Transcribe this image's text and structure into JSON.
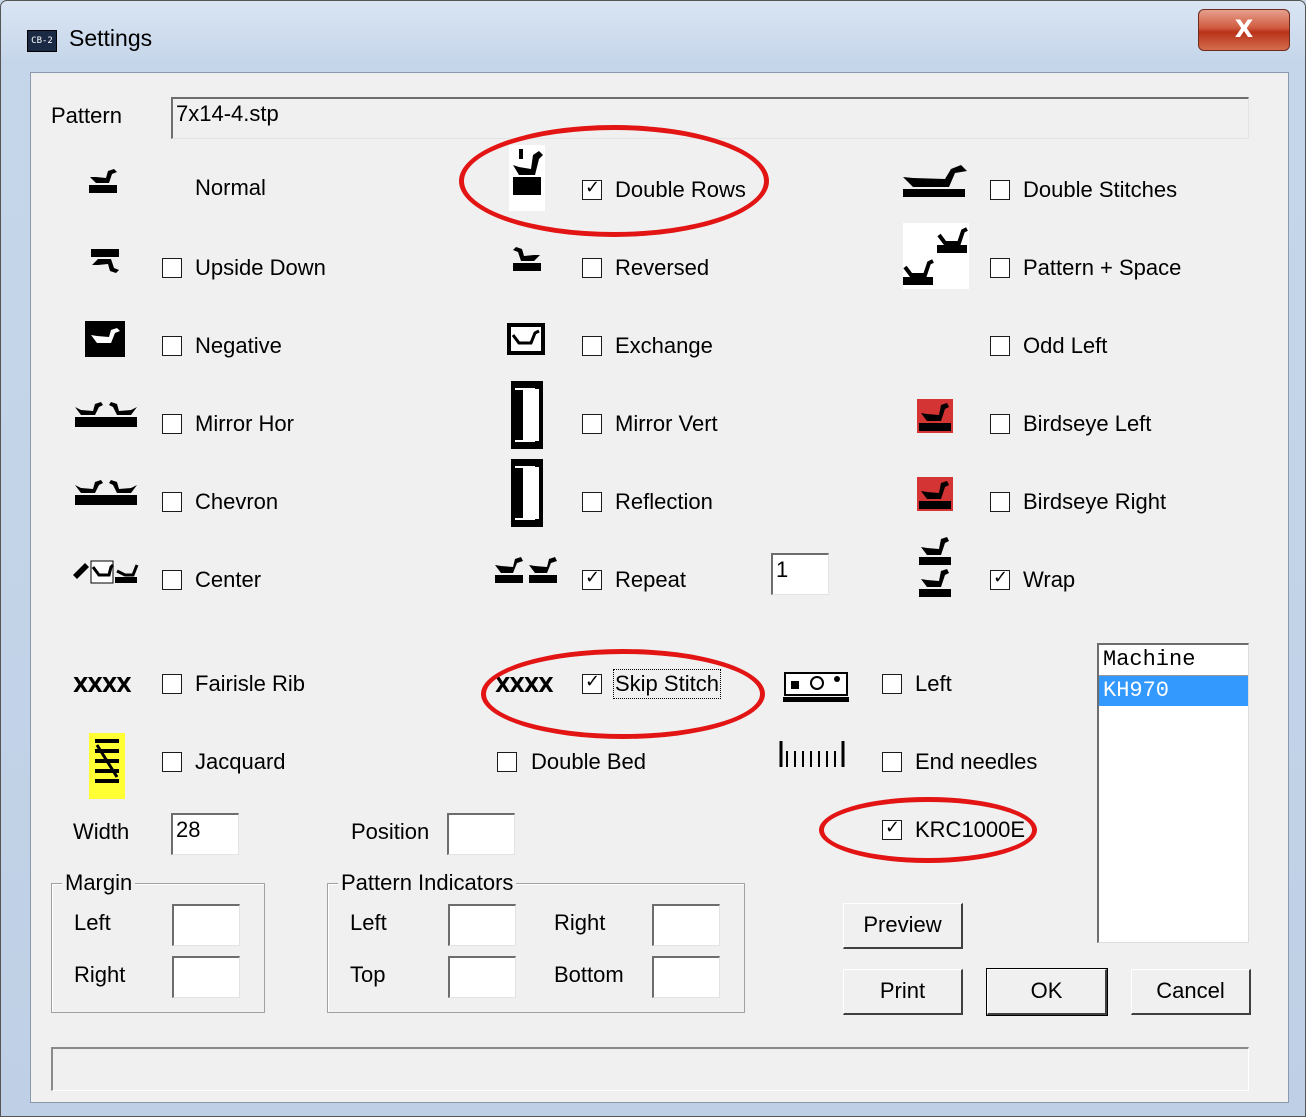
{
  "window": {
    "title": "Settings",
    "close_label": "X",
    "title_icon_label": "CB-2"
  },
  "pattern": {
    "label": "Pattern",
    "value": "7x14-4.stp"
  },
  "options": {
    "normal": {
      "label": "Normal"
    },
    "upside_down": {
      "label": "Upside Down",
      "checked": false
    },
    "negative": {
      "label": "Negative",
      "checked": false
    },
    "mirror_hor": {
      "label": "Mirror Hor",
      "checked": false
    },
    "chevron": {
      "label": "Chevron",
      "checked": false
    },
    "center": {
      "label": "Center",
      "checked": false
    },
    "fairisle_rib": {
      "label": "Fairisle Rib",
      "checked": false
    },
    "jacquard": {
      "label": "Jacquard",
      "checked": false
    },
    "double_rows": {
      "label": "Double Rows",
      "checked": true
    },
    "reversed": {
      "label": "Reversed",
      "checked": false
    },
    "exchange": {
      "label": "Exchange",
      "checked": false
    },
    "mirror_vert": {
      "label": "Mirror Vert",
      "checked": false
    },
    "reflection": {
      "label": "Reflection",
      "checked": false
    },
    "repeat": {
      "label": "Repeat",
      "checked": true,
      "count": "1"
    },
    "skip_stitch": {
      "label": "Skip Stitch",
      "checked": true
    },
    "double_bed": {
      "label": "Double Bed",
      "checked": false
    },
    "double_stitches": {
      "label": "Double Stitches",
      "checked": false
    },
    "pattern_space": {
      "label": "Pattern + Space",
      "checked": false
    },
    "odd_left": {
      "label": "Odd Left",
      "checked": false
    },
    "birdseye_left": {
      "label": "Birdseye Left",
      "checked": false
    },
    "birdseye_right": {
      "label": "Birdseye Right",
      "checked": false
    },
    "wrap": {
      "label": "Wrap",
      "checked": true
    },
    "left": {
      "label": "Left",
      "checked": false
    },
    "end_needles": {
      "label": "End needles",
      "checked": false
    },
    "krc1000e": {
      "label": "KRC1000E",
      "checked": true
    }
  },
  "xxxx_text": "XXXX",
  "width": {
    "label": "Width",
    "value": "28"
  },
  "position": {
    "label": "Position",
    "value": ""
  },
  "margin": {
    "title": "Margin",
    "left_label": "Left",
    "right_label": "Right",
    "left_value": "",
    "right_value": ""
  },
  "indicators": {
    "title": "Pattern Indicators",
    "left_label": "Left",
    "top_label": "Top",
    "right_label": "Right",
    "bottom_label": "Bottom"
  },
  "buttons": {
    "preview": "Preview",
    "print": "Print",
    "ok": "OK",
    "cancel": "Cancel"
  },
  "machine": {
    "header": "Machine",
    "items": [
      "KH970"
    ],
    "selected": "KH970"
  },
  "colors": {
    "highlight": "#e31414",
    "selection": "#3399ff"
  }
}
